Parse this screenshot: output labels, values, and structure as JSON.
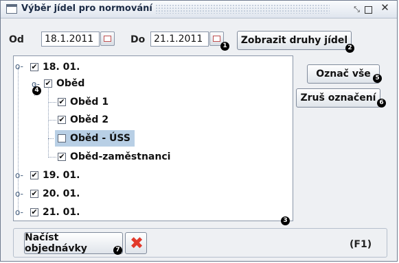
{
  "window": {
    "title": "Výběr jídel pro normování"
  },
  "filters": {
    "from_label": "Od",
    "from_value": "18.1.2011",
    "to_label": "Do",
    "to_value": "21.1.2011",
    "show_button": "Zobrazit druhy jídel"
  },
  "side_buttons": {
    "select_all": "Označ vše",
    "deselect": "Zruš označení"
  },
  "tree": {
    "nodes": [
      {
        "label": "18. 01.",
        "checked": true
      },
      {
        "label": "Oběd",
        "checked": true
      },
      {
        "label": "Oběd 1",
        "checked": true
      },
      {
        "label": "Oběd 2",
        "checked": true
      },
      {
        "label": "Oběd - ÚSS",
        "checked": false,
        "selected": true
      },
      {
        "label": "Oběd-zaměstnanci",
        "checked": true
      },
      {
        "label": "19. 01.",
        "checked": true
      },
      {
        "label": "20. 01.",
        "checked": true
      },
      {
        "label": "21. 01.",
        "checked": true
      }
    ]
  },
  "bottom": {
    "load_button": "Načíst objednávky",
    "hotkey": "(F1)"
  },
  "badges": [
    "1",
    "2",
    "3",
    "4",
    "5",
    "6",
    "7"
  ],
  "icons": {
    "calendar": "calendar-icon",
    "cancel": "red-x-icon"
  }
}
